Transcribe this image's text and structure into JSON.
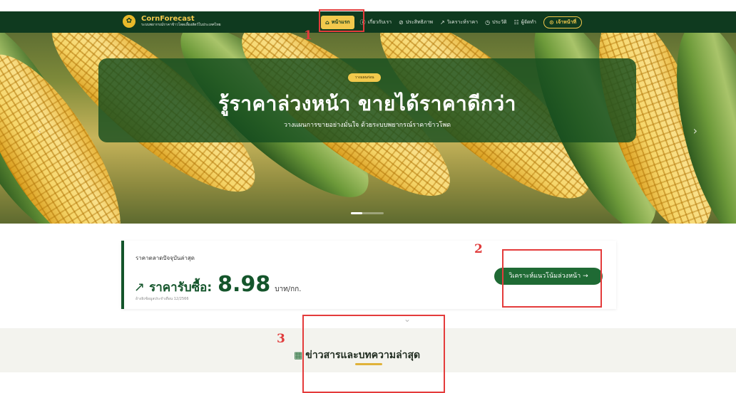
{
  "brand": {
    "name": "CornForecast",
    "tagline": "ระบบพยากรณ์ราคาข้าวโพดเลี้ยงสัตว์ในประเทศไทย",
    "accent_color": "#f2c94c",
    "primary_color": "#0f3a1f",
    "logo_icon": "corn-icon"
  },
  "nav": {
    "home": "หน้าแรก",
    "about": "เกี่ยวกับเรา",
    "performance": "ประสิทธิภาพ",
    "price_analysis": "วิเคราะห์ราคา",
    "history": "ประวัติ",
    "developers": "ผู้จัดทำ",
    "login": "เจ้าหน้าที่"
  },
  "hero": {
    "badge": "วางแผนก่อน",
    "title": "รู้ราคาล่วงหน้า ขายได้ราคาดีกว่า",
    "subtitle": "วางแผนการขายอย่างมั่นใจ ด้วยระบบพยากรณ์ราคาข้าวโพด"
  },
  "price": {
    "caption": "ราคาตลาดปัจจุบันล่าสุด",
    "label": "ราคารับซื้อ:",
    "value": "8.98",
    "unit": "บาท/กก.",
    "updated": "อ้างอิงข้อมูลประจำเดือน 12/2566",
    "trend_button": "วิเคราะห์แนวโน้มล่วงหน้า →"
  },
  "news": {
    "title": "ข่าวสารและบทความล่าสุด"
  },
  "annotations": {
    "n1": "1",
    "n2": "2",
    "n3": "3",
    "color": "#e43b3b"
  }
}
